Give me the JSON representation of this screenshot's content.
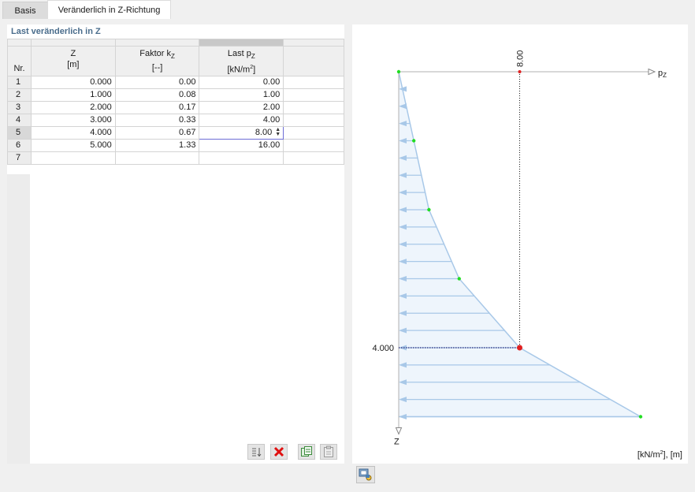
{
  "tabs": [
    {
      "label": "Basis",
      "active": false
    },
    {
      "label": "Veränderlich in Z-Richtung",
      "active": true
    }
  ],
  "table": {
    "title": "Last veränderlich in Z",
    "headers": {
      "nr": "Nr.",
      "z": {
        "name": "Z",
        "unit": "[m]"
      },
      "faktor": {
        "name": "Faktor k",
        "sub": "Z",
        "unit": "[--]"
      },
      "last": {
        "name": "Last p",
        "sub": "Z",
        "unit": "[kN/m",
        "sup": "2",
        "unit_end": "]"
      }
    },
    "rows": [
      {
        "nr": "1",
        "z": "0.000",
        "faktor": "0.00",
        "last": "0.00"
      },
      {
        "nr": "2",
        "z": "1.000",
        "faktor": "0.08",
        "last": "1.00"
      },
      {
        "nr": "3",
        "z": "2.000",
        "faktor": "0.17",
        "last": "2.00"
      },
      {
        "nr": "4",
        "z": "3.000",
        "faktor": "0.33",
        "last": "4.00"
      },
      {
        "nr": "5",
        "z": "4.000",
        "faktor": "0.67",
        "last": "8.00"
      },
      {
        "nr": "6",
        "z": "5.000",
        "faktor": "1.33",
        "last": "16.00"
      },
      {
        "nr": "7",
        "z": "",
        "faktor": "",
        "last": ""
      }
    ],
    "selected_row": 5
  },
  "diagram": {
    "axis_p": "p",
    "axis_p_sub": "Z",
    "axis_z": "Z",
    "selected_value_label": "8.00",
    "selected_depth_label": "4.000",
    "units": "[kN/m",
    "units_sup": "2",
    "units_end": "], [m]",
    "colors": {
      "fill": "#eef5fc",
      "line": "#a8c8e8",
      "node": "#22dd22",
      "selected": "#e02020"
    },
    "points": [
      {
        "z": 0,
        "p": 0
      },
      {
        "z": 1,
        "p": 1
      },
      {
        "z": 2,
        "p": 2
      },
      {
        "z": 3,
        "p": 4
      },
      {
        "z": 4,
        "p": 8
      },
      {
        "z": 5,
        "p": 16
      }
    ],
    "selected_index": 4
  },
  "toolbar": {
    "icons": [
      "sort-icon",
      "delete-icon",
      "copy-icon",
      "paste-icon",
      "diagram-options-icon"
    ]
  }
}
